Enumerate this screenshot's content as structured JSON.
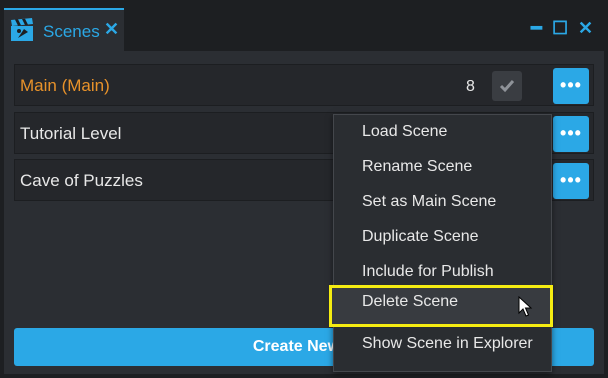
{
  "tab": {
    "title": "Scenes",
    "close_glyph": "✕",
    "icon": "clapperboard-icon"
  },
  "window_controls": {
    "collapse": "━",
    "maximize": "☐",
    "close": "✕"
  },
  "scenes": [
    {
      "name": "Main (Main)",
      "is_main": true,
      "count": "8",
      "has_check": true
    },
    {
      "name": "Tutorial Level",
      "is_main": false
    },
    {
      "name": "Cave of Puzzles",
      "is_main": false
    }
  ],
  "more_button_label": "•••",
  "create_button_label": "Create New S",
  "context_menu": {
    "items": [
      "Load Scene",
      "Rename Scene",
      "Set as Main Scene",
      "Duplicate Scene",
      "Include for Publish",
      "Delete Scene",
      "Show Scene in Explorer"
    ],
    "highlighted": "Delete Scene"
  },
  "colors": {
    "accent": "#2ba8e6",
    "main_scene": "#e8922a",
    "highlight_border": "#f5ec12",
    "background": "#1d1f22",
    "panel": "#2b2e33"
  }
}
